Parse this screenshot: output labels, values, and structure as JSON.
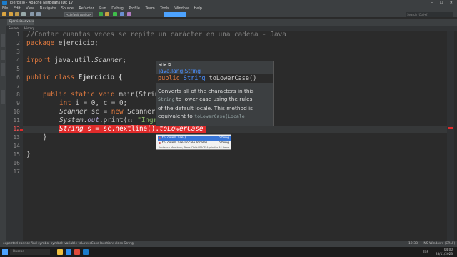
{
  "window": {
    "title": "Ejercicio - Apache NetBeans IDE 17",
    "controls": "– ☐ ✕"
  },
  "menu": [
    "File",
    "Edit",
    "View",
    "Navigate",
    "Source",
    "Refactor",
    "Run",
    "Debug",
    "Profile",
    "Team",
    "Tools",
    "Window",
    "Help"
  ],
  "toolbar": {
    "config": "<default config>",
    "search_placeholder": "Search (Ctrl+I)"
  },
  "tabs": {
    "file": "Ejercicio.java ×",
    "source": "Source",
    "history": "History"
  },
  "code": {
    "lines": [
      "1",
      "2",
      "3",
      "4",
      "5",
      "6",
      "7",
      "8",
      "9",
      "10",
      "11",
      "12",
      "13",
      "14",
      "15",
      "16",
      "17"
    ],
    "l1": "//Contar cuantas veces se repite un carácter en una cadena - Java",
    "l2_kw": "package",
    "l2_rest": " ejercicio;",
    "l4_kw": "import",
    "l4_rest": " java.util.",
    "l4_cls": "Scanner",
    "l4_end": ";",
    "l6_kw": "public class",
    "l6_rest": " Ejercicio {",
    "l8_kw": "public static void",
    "l8_rest": " main(Strin",
    "l9_kw": "int",
    "l9_rest": " i = 0, c = 0;",
    "l10_a": "Scanner",
    "l10_b": " sc = ",
    "l10_kw": "new",
    "l10_c": " Scanner",
    "l11_a": "System",
    "l11_b": ".",
    "l11_c": "out",
    "l11_d": ".print(",
    "l11_e": "s:",
    "l11_f": " \"Ingr",
    "l12_a": "String",
    "l12_b": " s = sc.nextline().",
    "l12_c": "toLowerCase",
    "l13": "}",
    "l15": "}"
  },
  "doc": {
    "nav": "◀ ▶ ⧉",
    "package": "java.lang.String",
    "sig_kw": "public",
    "sig_type": "String",
    "sig_name": " toLowerCase()",
    "body_1": "Converts all of the characters in this",
    "body_2a": "String",
    "body_2b": " to lower case using the rules",
    "body_3": "of the default locale. This method is",
    "body_4a": "equivalent to ",
    "body_4b": "toLowerCase(Locale."
  },
  "completion": {
    "items": [
      {
        "label": "toLowerCase()",
        "ret": "String"
      },
      {
        "label": "toLowerCase(Locale locale)",
        "ret": "String"
      }
    ],
    "hint": "Instance Members; Press Ctrl+SPACE Again for All Items"
  },
  "status": {
    "left": "expected  cannot find symbol  symbol: variable toLowerCase  location: class String",
    "pos": "12:38",
    "mode": "INS  Windows (CRLF)"
  },
  "taskbar": {
    "search": "Buscar",
    "time": "04:00",
    "date": "28/11/2023",
    "lang": "ESP"
  },
  "colors": {
    "error": "#e02b2b",
    "accent": "#3875d7",
    "keyword": "#e27a3f"
  }
}
